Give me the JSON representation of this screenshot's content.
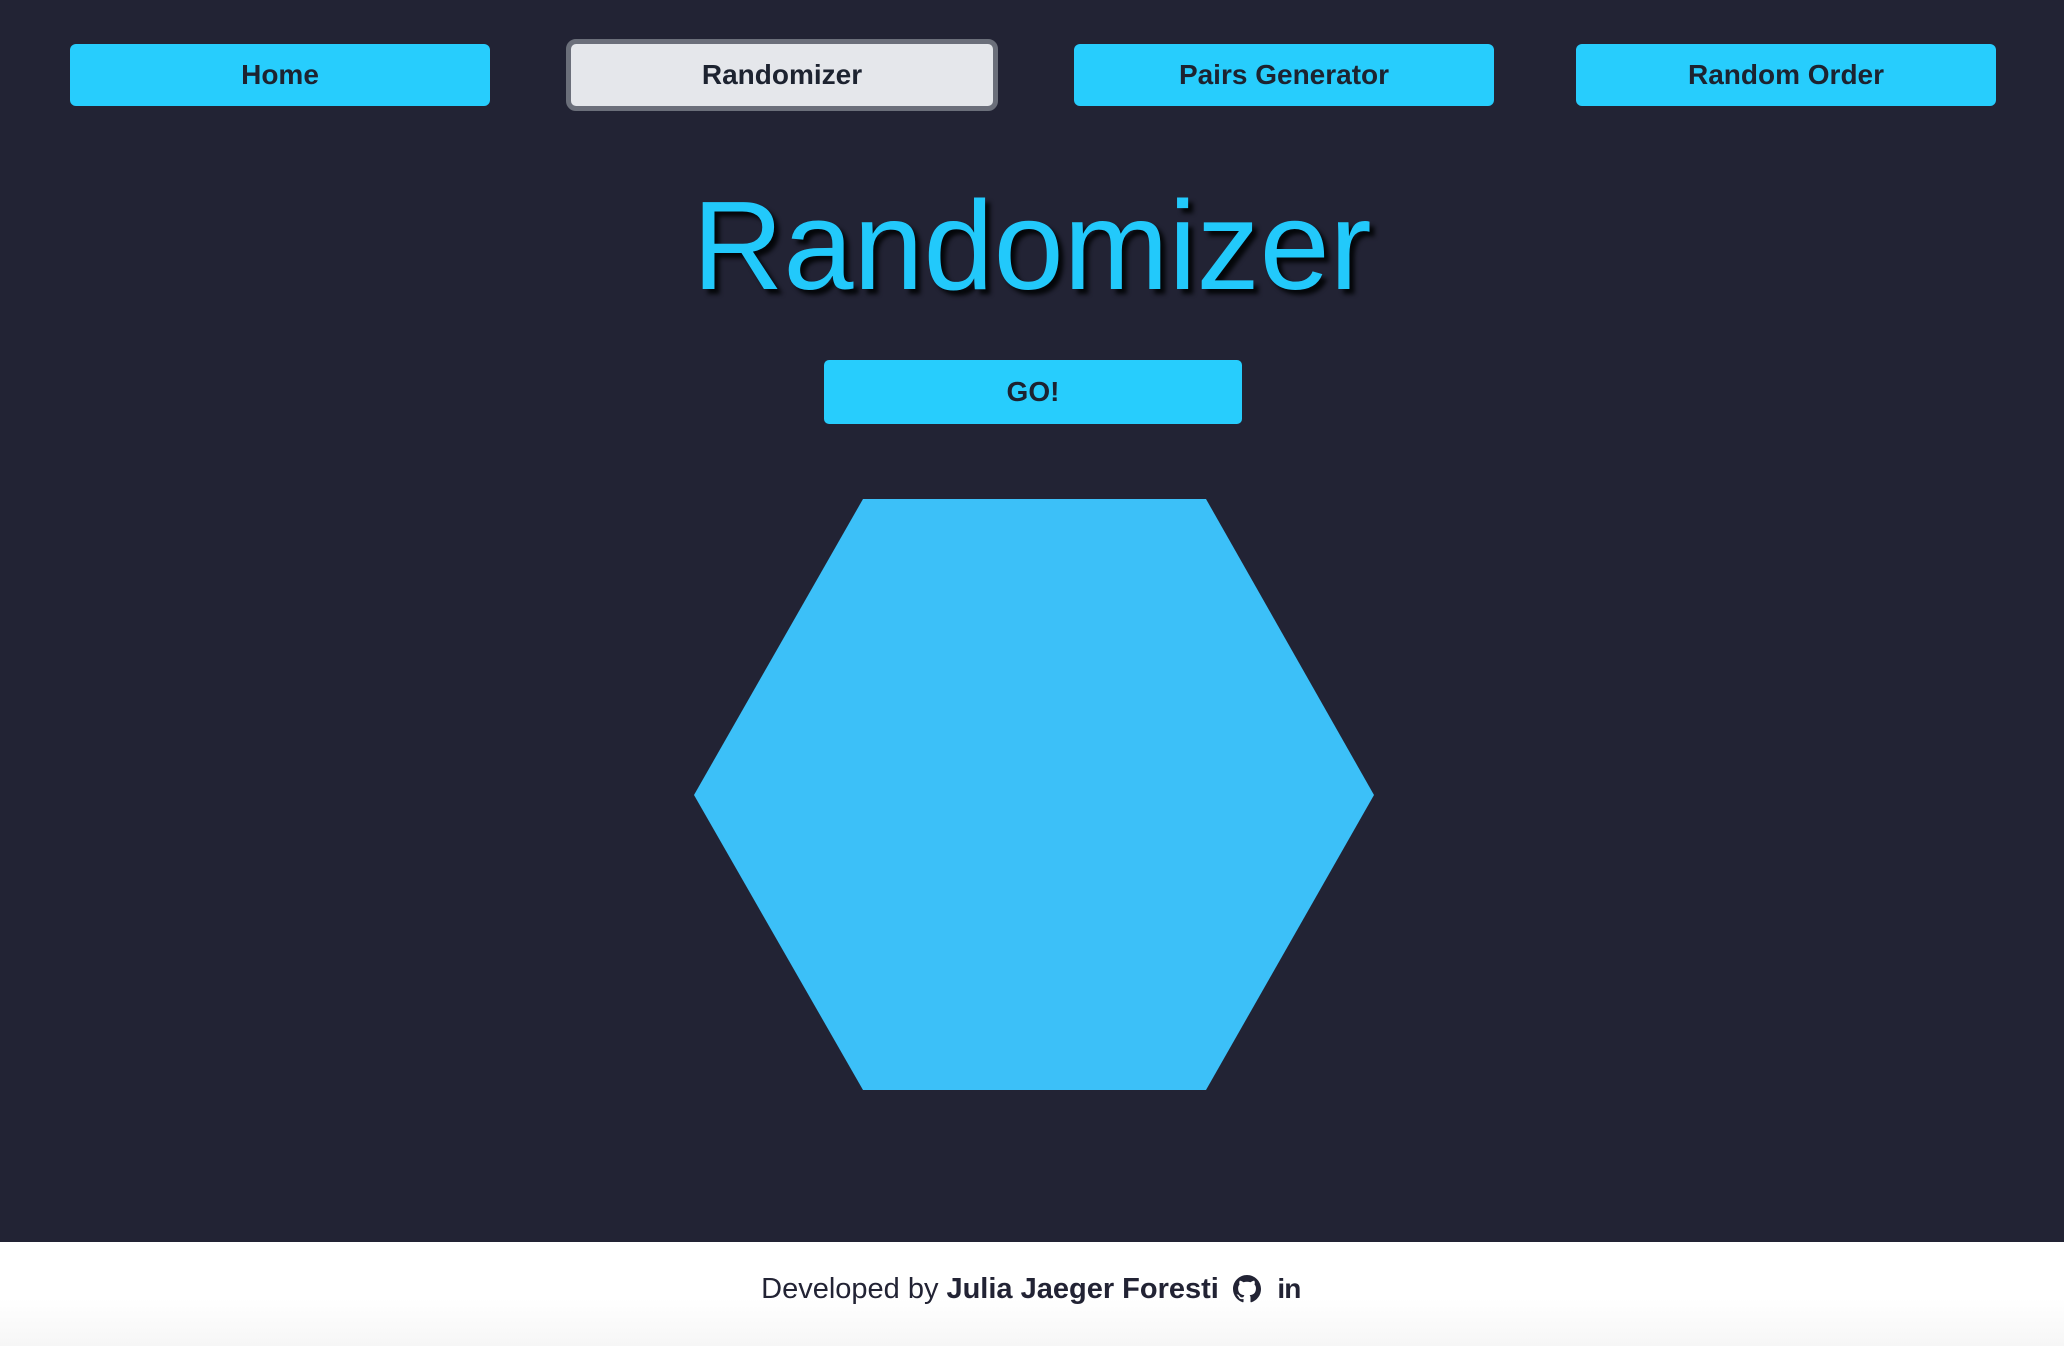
{
  "nav": {
    "items": [
      {
        "label": "Home"
      },
      {
        "label": "Randomizer"
      },
      {
        "label": "Pairs Generator"
      },
      {
        "label": "Random Order"
      }
    ],
    "active": "Randomizer"
  },
  "main": {
    "title": "Randomizer",
    "go_label": "GO!"
  },
  "footer": {
    "prefix": "Developed by",
    "name": "Julia Jaeger Foresti",
    "icons": [
      "github-icon",
      "linkedin-icon"
    ]
  },
  "colors": {
    "background": "#222334",
    "accent": "#27cdfd",
    "hexagon": "#3cc0f8",
    "active_button": "#e5e7eb"
  }
}
